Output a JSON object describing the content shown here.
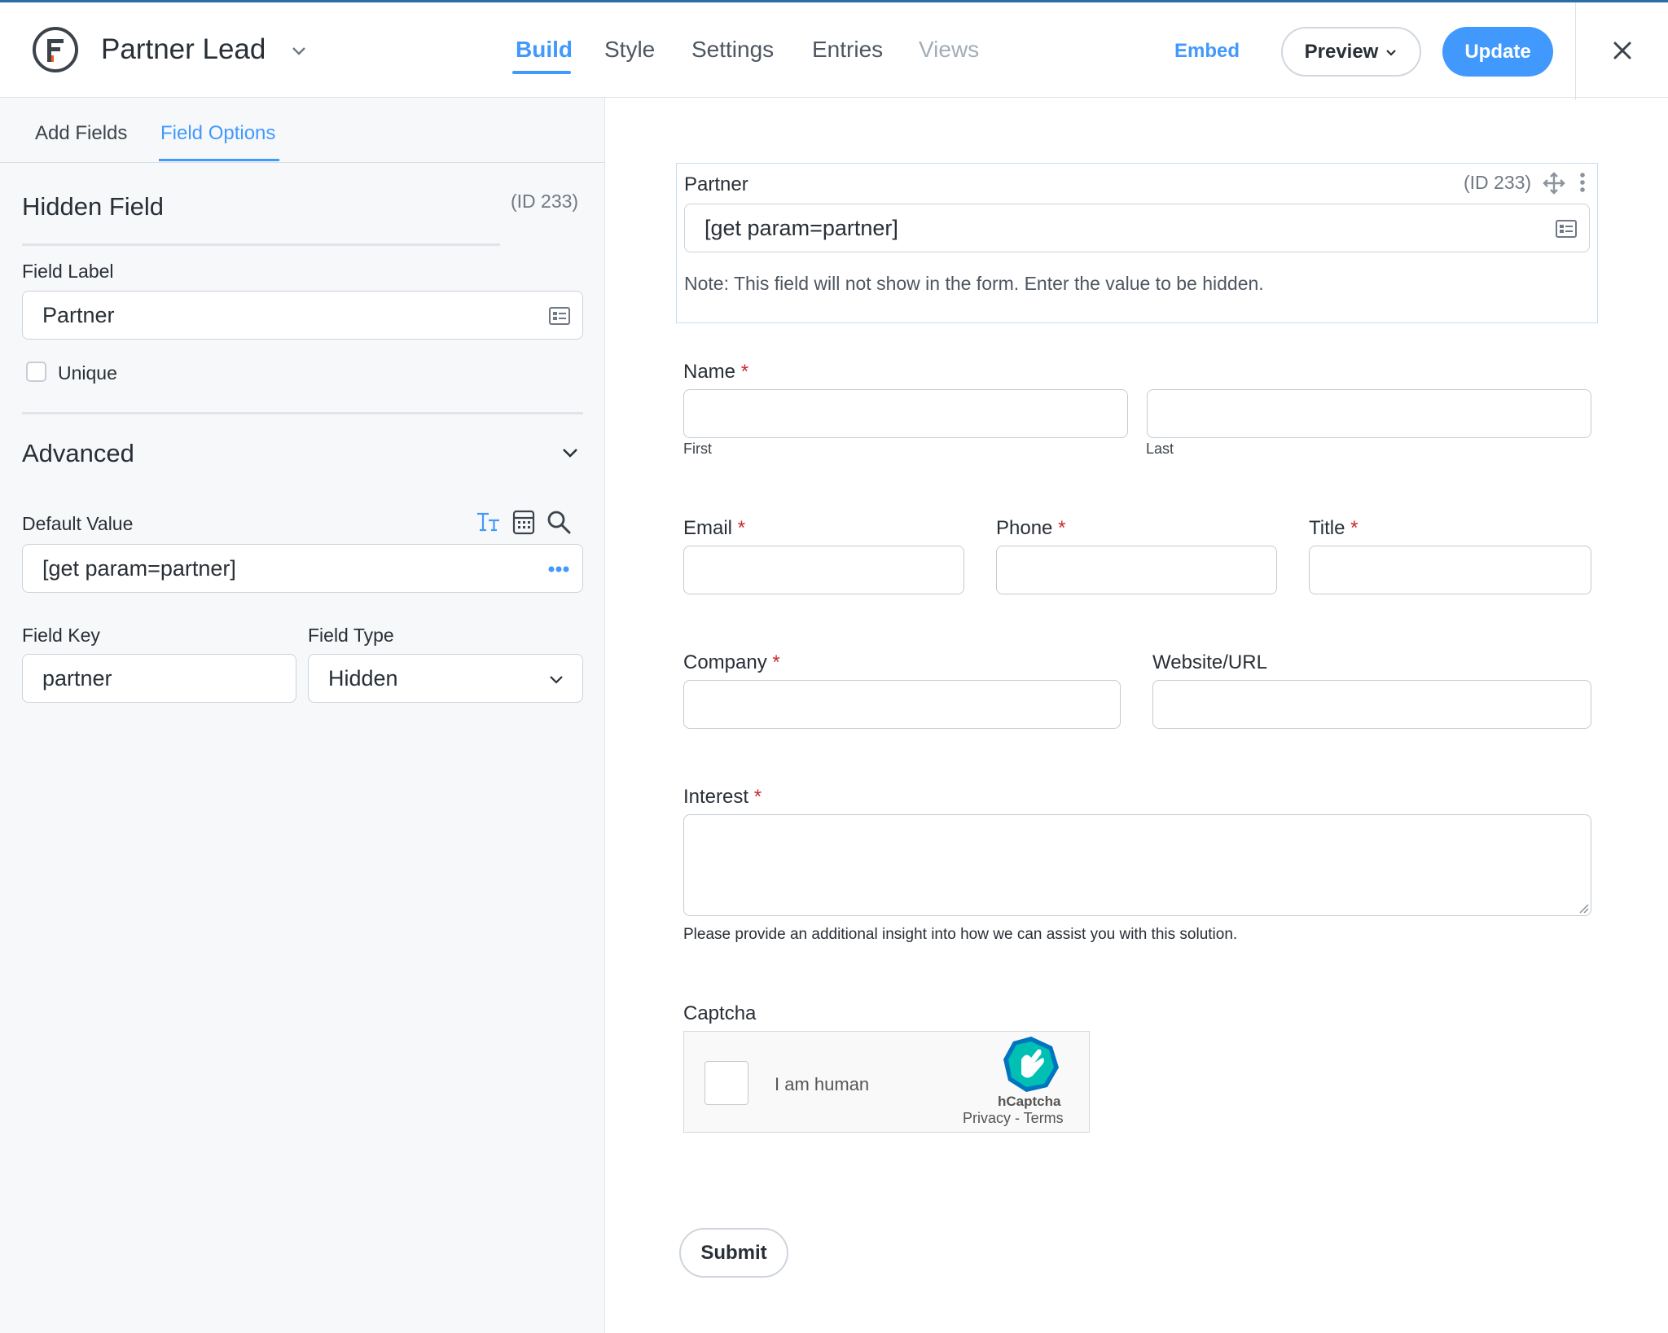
{
  "header": {
    "form_title": "Partner Lead",
    "tabs": [
      {
        "label": "Build",
        "state": "active"
      },
      {
        "label": "Style",
        "state": "normal"
      },
      {
        "label": "Settings",
        "state": "normal"
      },
      {
        "label": "Entries",
        "state": "normal"
      },
      {
        "label": "Views",
        "state": "disabled"
      }
    ],
    "embed_label": "Embed",
    "preview_label": "Preview",
    "update_label": "Update",
    "accent_color": "#4199fd"
  },
  "left_panel": {
    "tabs": [
      {
        "label": "Add Fields",
        "state": "normal"
      },
      {
        "label": "Field Options",
        "state": "active"
      }
    ],
    "field_title": "Hidden Field",
    "field_id": "(ID 233)",
    "field_label_caption": "Field Label",
    "field_label_value": "Partner",
    "unique_label": "Unique",
    "unique_checked": false,
    "advanced_title": "Advanced",
    "default_value_caption": "Default Value",
    "default_value": "[get param=partner]",
    "field_key_caption": "Field Key",
    "field_key_value": "partner",
    "field_type_caption": "Field Type",
    "field_type_value": "Hidden"
  },
  "form": {
    "hidden_field": {
      "label": "Partner",
      "id": "(ID 233)",
      "value": "[get param=partner]",
      "note": "Note: This field will not show in the form. Enter the value to be hidden."
    },
    "name": {
      "label": "Name",
      "required": "*",
      "first": "First",
      "last": "Last"
    },
    "email": {
      "label": "Email",
      "required": "*"
    },
    "phone": {
      "label": "Phone",
      "required": "*"
    },
    "title": {
      "label": "Title",
      "required": "*"
    },
    "company": {
      "label": "Company",
      "required": "*"
    },
    "website": {
      "label": "Website/URL"
    },
    "interest": {
      "label": "Interest",
      "required": "*",
      "description": "Please provide an additional insight into how we can assist you with this solution."
    },
    "captcha": {
      "label": "Captcha",
      "checkbox_text": "I am human",
      "brand": "hCaptcha",
      "links": "Privacy - Terms"
    },
    "submit_label": "Submit"
  }
}
